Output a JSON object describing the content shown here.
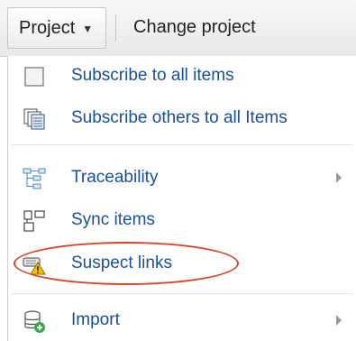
{
  "toolbar": {
    "project_label": "Project",
    "project_caret": "▼",
    "change_project_label": "Change project"
  },
  "menu": {
    "items": [
      {
        "label": "Subscribe to all items",
        "icon": "checkbox-icon"
      },
      {
        "label": "Subscribe others to all Items",
        "icon": "stacked-pages-icon"
      },
      {
        "label": "Traceability",
        "icon": "tree-icon",
        "submenu": true
      },
      {
        "label": "Sync items",
        "icon": "sync-icon"
      },
      {
        "label": "Suspect links",
        "icon": "warning-link-icon",
        "highlighted": true
      },
      {
        "label": "Import",
        "icon": "import-icon",
        "submenu": true
      }
    ]
  },
  "colors": {
    "link_blue": "#1a4fa0",
    "highlight_red": "#d9432a"
  }
}
